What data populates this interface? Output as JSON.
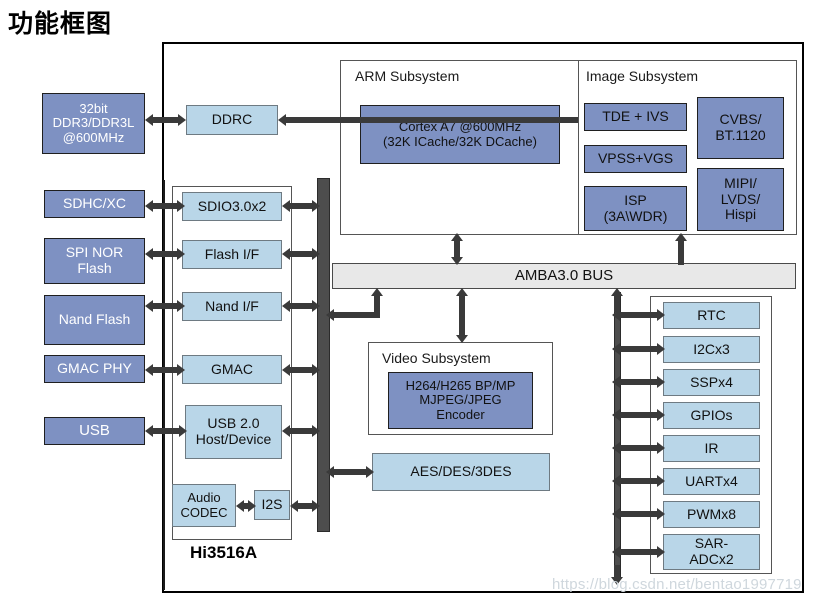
{
  "page": {
    "title": "功能框图",
    "chip_label": "Hi3516A",
    "watermark": "https://blog.csdn.net/bentao1997719"
  },
  "colors": {
    "block_dark_blue": "#7e91c2",
    "block_light_blue": "#b9d6e8",
    "bus_gray": "#e8e8e8",
    "vertical_bus": "#4d4d4d",
    "arrow": "#3a3a3a",
    "frame": "#000000"
  },
  "external": {
    "items": [
      {
        "id": "ddr",
        "label": "32bit\nDDR3/DDR3L\n@600MHz"
      },
      {
        "id": "sdhc",
        "label": "SDHC/XC"
      },
      {
        "id": "spinor",
        "label": "SPI NOR\nFlash"
      },
      {
        "id": "nandflash",
        "label": "Nand Flash"
      },
      {
        "id": "gmacphy",
        "label": "GMAC PHY"
      },
      {
        "id": "usb",
        "label": "USB"
      }
    ]
  },
  "left_interfaces": {
    "items": [
      {
        "id": "ddrc",
        "label": "DDRC"
      },
      {
        "id": "sdio",
        "label": "SDIO3.0x2"
      },
      {
        "id": "flashif",
        "label": "Flash I/F"
      },
      {
        "id": "nandif",
        "label": "Nand I/F"
      },
      {
        "id": "gmac",
        "label": "GMAC"
      },
      {
        "id": "usb20",
        "label": "USB 2.0\nHost/Device"
      },
      {
        "id": "audiocodec",
        "label": "Audio\nCODEC"
      },
      {
        "id": "i2s",
        "label": "I2S"
      }
    ]
  },
  "arm_subsystem": {
    "title": "ARM Subsystem",
    "blocks": [
      {
        "id": "cortex",
        "label": "Cortex A7 @600MHz\n(32K ICache/32K DCache)"
      }
    ]
  },
  "image_subsystem": {
    "title": "Image Subsystem",
    "blocks": [
      {
        "id": "tde",
        "label": "TDE + IVS"
      },
      {
        "id": "vpss",
        "label": "VPSS+VGS"
      },
      {
        "id": "isp",
        "label": "ISP\n(3A\\WDR)"
      },
      {
        "id": "cvbs",
        "label": "CVBS/\nBT.1120"
      },
      {
        "id": "mipi",
        "label": "MIPI/\nLVDS/\nHispi"
      }
    ]
  },
  "video_subsystem": {
    "title": "Video Subsystem",
    "blocks": [
      {
        "id": "encoder",
        "label": "H264/H265 BP/MP\nMJPEG/JPEG\nEncoder"
      }
    ]
  },
  "bus": {
    "label": "AMBA3.0 BUS"
  },
  "crypto": {
    "label": "AES/DES/3DES"
  },
  "right_peripherals": {
    "items": [
      {
        "id": "rtc",
        "label": "RTC"
      },
      {
        "id": "i2c",
        "label": "I2Cx3"
      },
      {
        "id": "ssp",
        "label": "SSPx4"
      },
      {
        "id": "gpio",
        "label": "GPIOs"
      },
      {
        "id": "ir",
        "label": "IR"
      },
      {
        "id": "uart",
        "label": "UARTx4"
      },
      {
        "id": "pwm",
        "label": "PWMx8"
      },
      {
        "id": "saradc",
        "label": "SAR-\nADCx2"
      }
    ]
  }
}
